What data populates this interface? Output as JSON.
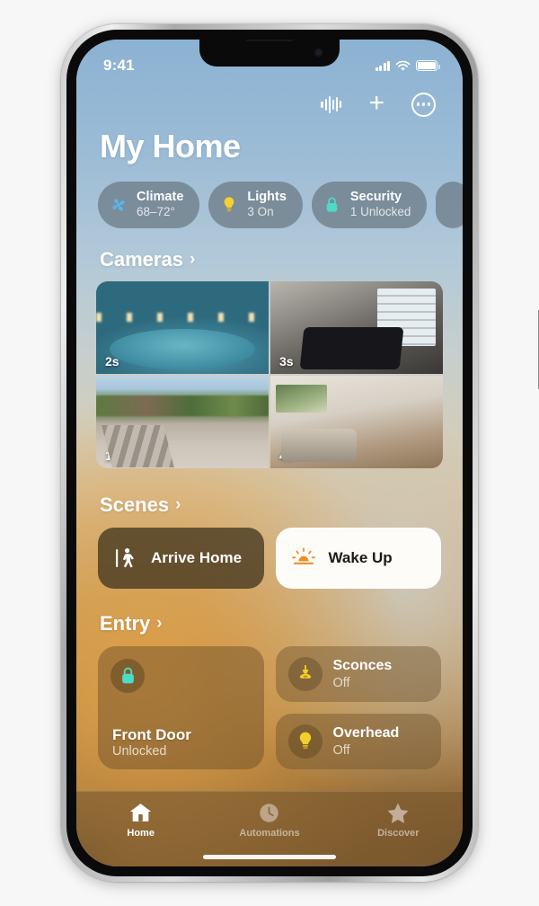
{
  "status_bar": {
    "time": "9:41",
    "icons": [
      "cellular-signal-icon",
      "wifi-icon",
      "battery-icon"
    ]
  },
  "toolbar": {
    "siri_label": "siri-waveform-icon",
    "add_label": "+",
    "more_label": "more-options-icon"
  },
  "header": {
    "title": "My Home"
  },
  "status_pills": [
    {
      "name": "Climate",
      "value": "68–72°",
      "icon": "fan-icon",
      "color": "#5bb4e8"
    },
    {
      "name": "Lights",
      "value": "3 On",
      "icon": "lightbulb-icon",
      "color": "#f5d130"
    },
    {
      "name": "Security",
      "value": "1 Unlocked",
      "icon": "lock-icon",
      "color": "#4cdbc4"
    }
  ],
  "cameras": {
    "title": "Cameras",
    "chevron": "›",
    "tiles": [
      {
        "name": "pool-camera",
        "time": "2s"
      },
      {
        "name": "garage-camera",
        "time": "3s"
      },
      {
        "name": "driveway-camera",
        "time": "1s"
      },
      {
        "name": "living-room-camera",
        "time": "4s"
      }
    ]
  },
  "scenes": {
    "title": "Scenes",
    "chevron": "›",
    "items": [
      {
        "name": "Arrive Home",
        "icon": "walking-person-icon",
        "style": "dark"
      },
      {
        "name": "Wake Up",
        "icon": "sunrise-icon",
        "style": "light"
      }
    ]
  },
  "entry": {
    "title": "Entry",
    "chevron": "›",
    "lock_tile": {
      "name": "Front Door",
      "state": "Unlocked",
      "icon": "lock-icon",
      "color": "#4cdbc4"
    },
    "accessories": [
      {
        "name": "Sconces",
        "state": "Off",
        "icon": "pendant-lamp-icon",
        "color": "#f2cf2c"
      },
      {
        "name": "Overhead",
        "state": "Off",
        "icon": "lightbulb-icon",
        "color": "#f2cf2c"
      }
    ]
  },
  "tab_bar": {
    "tabs": [
      {
        "label": "Home",
        "icon": "house-icon",
        "active": true
      },
      {
        "label": "Automations",
        "icon": "clock-icon",
        "active": false
      },
      {
        "label": "Discover",
        "icon": "star-icon",
        "active": false
      }
    ]
  }
}
